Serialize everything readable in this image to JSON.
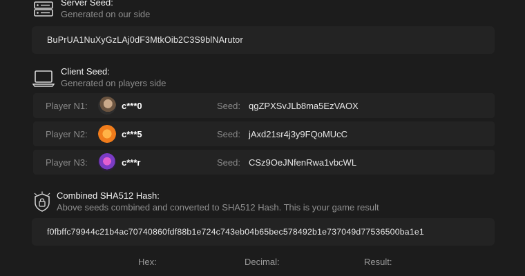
{
  "server_seed": {
    "title": "Server Seed:",
    "subtitle": "Generated on our side",
    "value": "BuPrUA1NuXyGzLAj0dF3MtkOib2C3S9blNArutor"
  },
  "client_seed": {
    "title": "Client Seed:",
    "subtitle": "Generated on players side",
    "players": [
      {
        "label": "Player N1:",
        "name": "c***0",
        "seed_label": "Seed:",
        "seed": "qgZPXSvJLb8ma5EzVAOX"
      },
      {
        "label": "Player N2:",
        "name": "c***5",
        "seed_label": "Seed:",
        "seed": "jAxd21sr4j3y9FQoMUcC"
      },
      {
        "label": "Player N3:",
        "name": "c***r",
        "seed_label": "Seed:",
        "seed": "CSz9OeJNfenRwa1vbcWL"
      }
    ]
  },
  "hash": {
    "title": "Combined SHA512 Hash:",
    "subtitle": "Above seeds combined and converted to SHA512 Hash. This is your game result",
    "value": "f0fbffc79944c21b4ac70740860fdf88b1e724c743eb04b65bec578492b1e737049d77536500ba1e1"
  },
  "result_labels": {
    "hex": "Hex:",
    "decimal": "Decimal:",
    "result": "Result:"
  }
}
